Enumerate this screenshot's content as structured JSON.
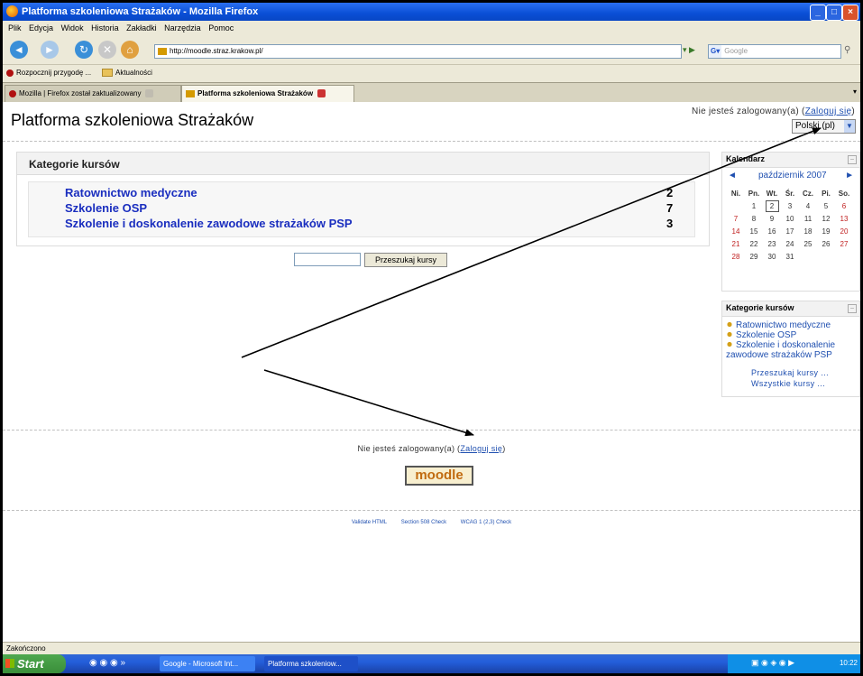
{
  "window": {
    "title": "Platforma szkoleniowa Strażaków - Mozilla Firefox"
  },
  "menu": [
    "Plik",
    "Edycja",
    "Widok",
    "Historia",
    "Zakładki",
    "Narzędzia",
    "Pomoc"
  ],
  "address": {
    "url": "http://moodle.straz.krakow.pl/"
  },
  "search_engine": {
    "placeholder": "Google"
  },
  "bookmarks": [
    {
      "label": "Rozpocznij przygodę ..."
    },
    {
      "label": "Aktualności"
    }
  ],
  "tabs": [
    {
      "label": "Mozilla | Firefox został zaktualizowany"
    },
    {
      "label": "Platforma szkoleniowa Strażaków"
    }
  ],
  "page": {
    "title": "Platforma szkoleniowa Strażaków",
    "login_prefix": "Nie jesteś zalogowany(a) (",
    "login_link": "Zaloguj się",
    "login_suffix": ")",
    "language": "Polski (pl)"
  },
  "categories_block": {
    "heading": "Kategorie kursów",
    "items": [
      {
        "name": "Ratownictwo medyczne",
        "count": "2"
      },
      {
        "name": "Szkolenie OSP",
        "count": "7"
      },
      {
        "name": "Szkolenie i doskonalenie zawodowe strażaków PSP",
        "count": "3"
      }
    ]
  },
  "search": {
    "button": "Przeszukaj kursy"
  },
  "calendar": {
    "heading": "Kalendarz",
    "prev": "◄",
    "next": "►",
    "month": "październik 2007",
    "days": [
      "Ni.",
      "Pn.",
      "Wt.",
      "Śr.",
      "Cz.",
      "Pi.",
      "So."
    ],
    "weeks": [
      [
        "",
        "1",
        "2",
        "3",
        "4",
        "5",
        "6"
      ],
      [
        "7",
        "8",
        "9",
        "10",
        "11",
        "12",
        "13"
      ],
      [
        "14",
        "15",
        "16",
        "17",
        "18",
        "19",
        "20"
      ],
      [
        "21",
        "22",
        "23",
        "24",
        "25",
        "26",
        "27"
      ],
      [
        "28",
        "29",
        "30",
        "31",
        "",
        "",
        ""
      ]
    ],
    "today": "2"
  },
  "side_categories": {
    "heading": "Kategorie kursów",
    "items": [
      "Ratownictwo medyczne",
      "Szkolenie OSP",
      "Szkolenie i doskonalenie zawodowe strażaków PSP"
    ],
    "search_link": "Przeszukaj kursy ...",
    "all_link": "Wszystkie kursy ..."
  },
  "footer": {
    "login_prefix": "Nie jesteś zalogowany(a) (",
    "login_link": "Zaloguj się",
    "login_suffix": ")",
    "logo": "moodle",
    "links": [
      "Validate HTML",
      "Section 508 Check",
      "WCAG 1 (2,3) Check"
    ]
  },
  "status": "Zakończono",
  "taskbar": {
    "start": "Start",
    "tasks": [
      "Google - Microsoft Int...",
      "Platforma szkoleniow..."
    ],
    "clock": "10:22"
  },
  "colors": {
    "link": "#1a2ebf",
    "titlebar": "#0a4fd6",
    "taskbar": "#245edb"
  }
}
